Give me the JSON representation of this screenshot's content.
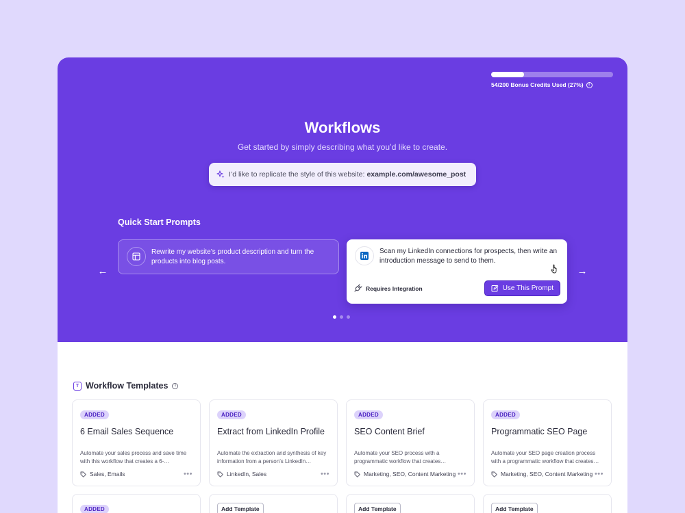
{
  "credits": {
    "label": "54/200 Bonus Credits Used (27%)",
    "used": 54,
    "total": 200,
    "percent": 27
  },
  "hero": {
    "title": "Workflows",
    "subtitle": "Get started by simply describing what you’d like to create.",
    "search_prefix": "I’d like to replicate the style of this website:",
    "search_link": "example.com/awesome_post"
  },
  "quick_start": {
    "title": "Quick Start Prompts",
    "cards": [
      {
        "text": "Rewrite my website’s product description and turn the products into blog posts.",
        "icon": "template-icon"
      },
      {
        "text": "Scan my LinkedIn connections for prospects, then write an introduction message to send to them.",
        "icon": "linkedin-icon",
        "requires": "Requires Integration",
        "button": "Use This Prompt"
      }
    ],
    "active_dot": 0,
    "dot_count": 3
  },
  "templates": {
    "title": "Workflow Templates",
    "cards": [
      {
        "badge": "ADDED",
        "title": "6 Email Sales Sequence",
        "desc": "Automate your sales process and save time with this workflow that creates a 6-…",
        "tags": "Sales, Emails"
      },
      {
        "badge": "ADDED",
        "title": "Extract from LinkedIn Profile",
        "desc": "Automate the extraction and synthesis of key information from a person’s LinkedIn…",
        "tags": "LinkedIn, Sales"
      },
      {
        "badge": "ADDED",
        "title": "SEO Content Brief",
        "desc": "Automate your SEO process with a programmatic workflow that creates…",
        "tags": "Marketing, SEO, Content Marketing"
      },
      {
        "badge": "ADDED",
        "title": "Programmatic SEO Page",
        "desc": "Automate your SEO page creation process with a programmatic workflow that creates…",
        "tags": "Marketing, SEO, Content Marketing"
      }
    ],
    "row2": [
      {
        "badge": "ADDED"
      },
      {
        "button": "Add Template"
      },
      {
        "button": "Add Template"
      },
      {
        "button": "Add Template"
      }
    ]
  },
  "colors": {
    "brand": "#6a3de2",
    "background": "#e0d9fd",
    "badge": "#dcd2fb"
  }
}
